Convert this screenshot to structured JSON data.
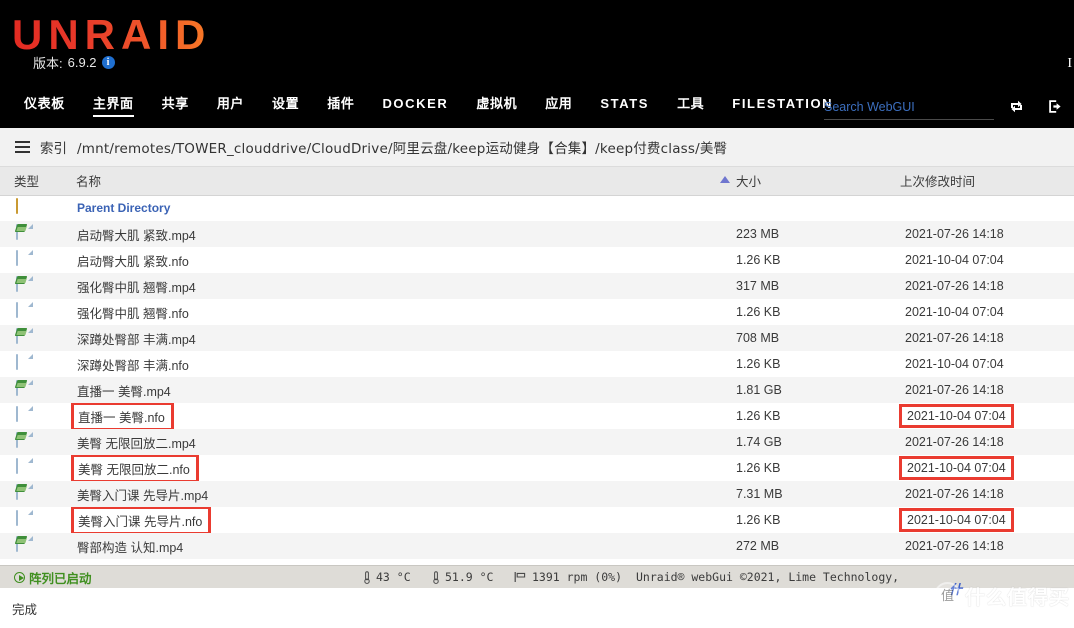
{
  "header": {
    "brand": "UNRAID",
    "version_label": "版本:",
    "version_value": "6.9.2",
    "info_icon_char": "i",
    "corner_glyph": "I",
    "nav_items": [
      {
        "label": "仪表板",
        "active": false,
        "latin": false
      },
      {
        "label": "主界面",
        "active": true,
        "latin": false
      },
      {
        "label": "共享",
        "active": false,
        "latin": false
      },
      {
        "label": "用户",
        "active": false,
        "latin": false
      },
      {
        "label": "设置",
        "active": false,
        "latin": false
      },
      {
        "label": "插件",
        "active": false,
        "latin": false
      },
      {
        "label": "DOCKER",
        "active": false,
        "latin": true
      },
      {
        "label": "虚拟机",
        "active": false,
        "latin": false
      },
      {
        "label": "应用",
        "active": false,
        "latin": false
      },
      {
        "label": "STATS",
        "active": false,
        "latin": true
      },
      {
        "label": "工具",
        "active": false,
        "latin": false
      },
      {
        "label": "FILESTATION",
        "active": false,
        "latin": true
      }
    ],
    "search": {
      "placeholder": "Search WebGUI",
      "value": ""
    },
    "icons": [
      {
        "name": "reboot-icon"
      },
      {
        "name": "logout-icon"
      }
    ],
    "brand_color_start": "#e32b22",
    "brand_color_end": "#f87a26",
    "search_text_color": "#3c6fbf"
  },
  "breadcrumb": {
    "menu_icon": "hamburger-icon",
    "label": "索引",
    "path": "/mnt/remotes/TOWER_clouddrive/CloudDrive/阿里云盘/keep运动健身【合集】/keep付费class/美臀"
  },
  "table": {
    "columns": [
      "类型",
      "名称",
      "大小",
      "上次修改时间"
    ],
    "sort_column": "大小",
    "sort_direction": "asc",
    "sort_arrow_color": "#6f76cf",
    "rows": [
      {
        "icon": "folder-up-icon",
        "name": "Parent Directory",
        "size": "",
        "date": "",
        "is_parent": true,
        "name_boxed": false,
        "date_boxed": false
      },
      {
        "icon": "video-file-icon",
        "name": "启动臀大肌 紧致.mp4",
        "size": "223 MB",
        "date": "2021-07-26 14:18",
        "is_parent": false,
        "name_boxed": false,
        "date_boxed": false
      },
      {
        "icon": "document-file-icon",
        "name": "启动臀大肌 紧致.nfo",
        "size": "1.26 KB",
        "date": "2021-10-04 07:04",
        "is_parent": false,
        "name_boxed": false,
        "date_boxed": false
      },
      {
        "icon": "video-file-icon",
        "name": "强化臀中肌 翘臀.mp4",
        "size": "317 MB",
        "date": "2021-07-26 14:18",
        "is_parent": false,
        "name_boxed": false,
        "date_boxed": false
      },
      {
        "icon": "document-file-icon",
        "name": "强化臀中肌 翘臀.nfo",
        "size": "1.26 KB",
        "date": "2021-10-04 07:04",
        "is_parent": false,
        "name_boxed": false,
        "date_boxed": false
      },
      {
        "icon": "video-file-icon",
        "name": "深蹲处臀部 丰满.mp4",
        "size": "708 MB",
        "date": "2021-07-26 14:18",
        "is_parent": false,
        "name_boxed": false,
        "date_boxed": false
      },
      {
        "icon": "document-file-icon",
        "name": "深蹲处臀部 丰满.nfo",
        "size": "1.26 KB",
        "date": "2021-10-04 07:04",
        "is_parent": false,
        "name_boxed": false,
        "date_boxed": false
      },
      {
        "icon": "video-file-icon",
        "name": "直播一 美臀.mp4",
        "size": "1.81 GB",
        "date": "2021-07-26 14:18",
        "is_parent": false,
        "name_boxed": false,
        "date_boxed": false
      },
      {
        "icon": "document-file-icon",
        "name": "直播一 美臀.nfo",
        "size": "1.26 KB",
        "date": "2021-10-04 07:04",
        "is_parent": false,
        "name_boxed": true,
        "date_boxed": true
      },
      {
        "icon": "video-file-icon",
        "name": "美臀 无限回放二.mp4",
        "size": "1.74 GB",
        "date": "2021-07-26 14:18",
        "is_parent": false,
        "name_boxed": false,
        "date_boxed": false
      },
      {
        "icon": "document-file-icon",
        "name": "美臀 无限回放二.nfo",
        "size": "1.26 KB",
        "date": "2021-10-04 07:04",
        "is_parent": false,
        "name_boxed": true,
        "date_boxed": true
      },
      {
        "icon": "video-file-icon",
        "name": "美臀入门课 先导片.mp4",
        "size": "7.31 MB",
        "date": "2021-07-26 14:18",
        "is_parent": false,
        "name_boxed": false,
        "date_boxed": false
      },
      {
        "icon": "document-file-icon",
        "name": "美臀入门课 先导片.nfo",
        "size": "1.26 KB",
        "date": "2021-10-04 07:04",
        "is_parent": false,
        "name_boxed": true,
        "date_boxed": true
      },
      {
        "icon": "video-file-icon",
        "name": "臀部构造 认知.mp4",
        "size": "272 MB",
        "date": "2021-07-26 14:18",
        "is_parent": false,
        "name_boxed": false,
        "date_boxed": false
      }
    ],
    "annotation_color": "#ea3b30"
  },
  "statusbar": {
    "array_status": "阵列已启动",
    "array_status_color": "#3f8f1f",
    "sensors": [
      {
        "icon": "thermometer-icon",
        "value": "43 °C"
      },
      {
        "icon": "thermometer-icon",
        "value": "51.9 °C"
      },
      {
        "icon": "fan-icon",
        "value": "1391 rpm (0%)"
      }
    ],
    "copyright": "Unraid® webGui ©2021, Lime Technology,"
  },
  "browser_status": {
    "text": "完成"
  },
  "watermark": {
    "circle_char": "值",
    "text": "什么值得买",
    "badge": "什"
  }
}
